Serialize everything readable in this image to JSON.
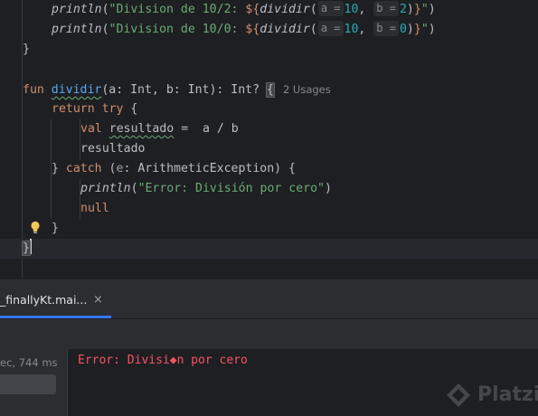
{
  "editor": {
    "lines": {
      "l1": {
        "fn": "println",
        "open": "(",
        "str1": "\"Division de 10/2: ",
        "interp_open": "${",
        "call": "dividir",
        "paren_open": "(",
        "hint_a": "a =",
        "val_a": "10",
        "comma": ", ",
        "hint_b": "b =",
        "val_b": "2",
        "close_call": ")",
        "interp_close": "}",
        "str_end": "\"",
        "close": ")"
      },
      "l2": {
        "fn": "println",
        "open": "(",
        "str1": "\"Division de 10/0: ",
        "interp_open": "${",
        "call": "dividir",
        "paren_open": "(",
        "hint_a": "a =",
        "val_a": "10",
        "comma": ", ",
        "hint_b": "b =",
        "val_b": "0",
        "close_call": ")",
        "interp_close": "}",
        "str_end": "\"",
        "close": ")"
      },
      "l3": {
        "text": "}"
      },
      "l5": {
        "kw": "fun",
        "name": "dividir",
        "sig": "(a: Int, b: Int): Int? ",
        "brace": "{",
        "usages": "2 Usages"
      },
      "l6": {
        "kw1": "return",
        "kw2": "try",
        "rest": " {"
      },
      "l7": {
        "kw": "val",
        "var": "resultado",
        "rest": " =  a / b"
      },
      "l8": {
        "text": "resultado"
      },
      "l9": {
        "pre": "} ",
        "kw": "catch",
        "open": " (",
        "param": "e",
        "rest": ": ArithmeticException) {"
      },
      "l10": {
        "fn": "println",
        "open": "(",
        "str": "\"Error: División por cero\"",
        "close": ")"
      },
      "l11": {
        "kw": "null"
      },
      "l12": {
        "text": "}"
      },
      "l13": {
        "text": "}"
      }
    },
    "bulb_icon": "lightbulb-icon"
  },
  "run_window": {
    "tab_label": "_finallyKt.mai...",
    "tab_close": "×",
    "elapsed": "ec, 744 ms",
    "console_output": "Error: Divisi◆n por cero"
  },
  "watermark": {
    "text": "Platzi"
  },
  "colors": {
    "background": "#1e1f22",
    "keyword": "#cf8e6d",
    "string": "#6aab73",
    "number": "#2aacb8",
    "function": "#56a8f5",
    "error": "#f75464",
    "accent": "#3574f0"
  }
}
